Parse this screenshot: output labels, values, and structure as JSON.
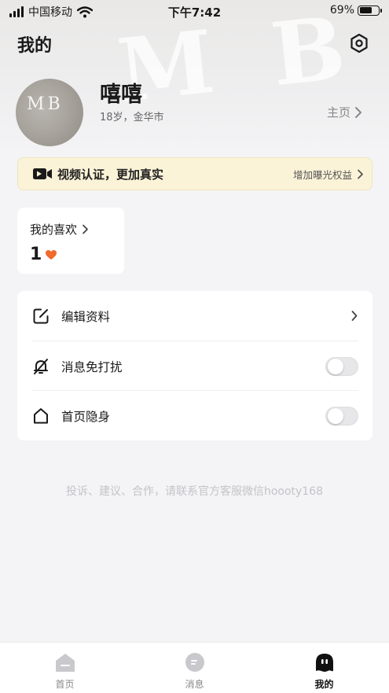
{
  "status_bar": {
    "carrier": "中国移动",
    "time": "下午7:42",
    "battery": "69%",
    "battery_level": 0.69
  },
  "header": {
    "title": "我的"
  },
  "profile": {
    "avatar_text": "MB",
    "name": "嘻嘻",
    "info": "18岁，金华市",
    "homepage_label": "主页"
  },
  "verify_banner": {
    "text": "视频认证，更加真实",
    "action": "增加曝光权益"
  },
  "likes": {
    "label": "我的喜欢",
    "count": "1"
  },
  "settings": [
    {
      "label": "编辑资料",
      "icon": "edit-icon",
      "control": "chevron"
    },
    {
      "label": "消息免打扰",
      "icon": "bell-off-icon",
      "control": "toggle",
      "on": false
    },
    {
      "label": "首页隐身",
      "icon": "home-outline-icon",
      "control": "toggle",
      "on": false
    }
  ],
  "footer_text": "投诉、建议、合作，请联系官方客服微信hoooty168",
  "tabbar": [
    {
      "label": "首页",
      "icon": "home-icon",
      "active": false
    },
    {
      "label": "消息",
      "icon": "message-icon",
      "active": false
    },
    {
      "label": "我的",
      "icon": "profile-icon",
      "active": true
    }
  ],
  "colors": {
    "accent_heart": "#f06a2c",
    "banner_bg": "#fbf3d8",
    "background": "#f4f4f6"
  }
}
